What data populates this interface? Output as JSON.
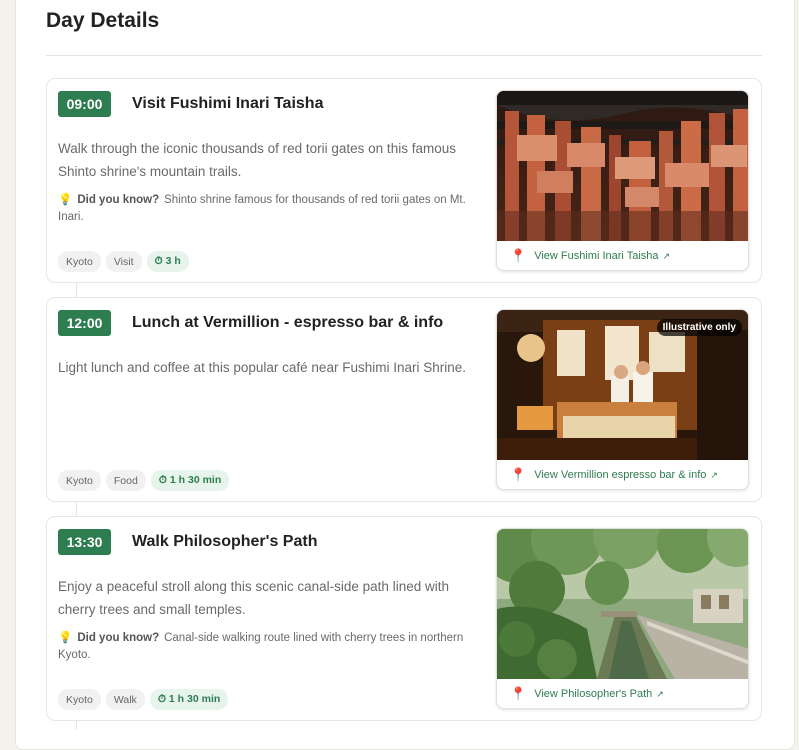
{
  "page": {
    "title": "Day Details"
  },
  "labels": {
    "did_you_know": "Did you know?",
    "illustrative": "Illustrative only"
  },
  "icons": {
    "tip": "lightbulb-icon",
    "pin": "map-pin-icon",
    "external": "external-link-icon",
    "duration": "stopwatch-icon"
  },
  "colors": {
    "accent": "#2e7d50",
    "pin": "#e0455f"
  },
  "activities": [
    {
      "time": "09:00",
      "title": "Visit Fushimi Inari Taisha",
      "description": "Walk through the iconic thousands of red torii gates on this famous Shinto shrine's mountain trails.",
      "tip": "Shinto shrine famous for thousands of red torii gates on Mt. Inari.",
      "tags": [
        "Kyoto",
        "Visit"
      ],
      "duration": "⏱ 3 h",
      "link": "View Fushimi Inari Taisha",
      "link_arrow": "↗"
    },
    {
      "time": "12:00",
      "title": "Lunch at Vermillion - espresso bar & info",
      "description": "Light lunch and coffee at this popular café near Fushimi Inari Shrine.",
      "tags": [
        "Kyoto",
        "Food"
      ],
      "duration": "⏱ 1 h 30 min",
      "link": "View Vermillion espresso bar & info",
      "link_arrow": "↗"
    },
    {
      "time": "13:30",
      "title": "Walk Philosopher's Path",
      "description": "Enjoy a peaceful stroll along this scenic canal-side path lined with cherry trees and small temples.",
      "tip": "Canal-side walking route lined with cherry trees in northern Kyoto.",
      "tags": [
        "Kyoto",
        "Walk"
      ],
      "duration": "⏱ 1 h 30 min",
      "link": "View Philosopher's Path",
      "link_arrow": "↗"
    }
  ]
}
